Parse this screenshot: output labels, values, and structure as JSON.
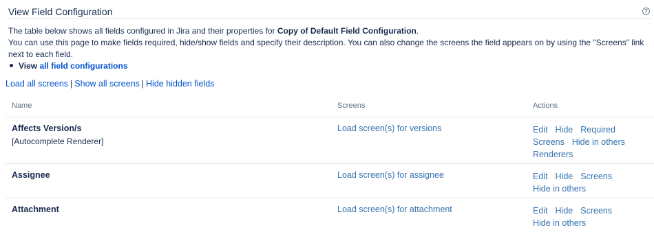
{
  "page": {
    "title": "View Field Configuration",
    "help_icon": "?"
  },
  "intro": {
    "line1_prefix": "The table below shows all fields configured in Jira and their properties for ",
    "config_name": "Copy of Default Field Configuration",
    "line1_suffix": ".",
    "line2": "You can use this page to make fields required, hide/show fields and specify their description. You can also change the screens the field appears on by using the \"Screens\" link next to each field."
  },
  "bullet": {
    "view_label": "View",
    "link_label": "all field configurations"
  },
  "toplinks": {
    "load_all": "Load all screens",
    "show_all": "Show all screens",
    "hide_hidden": "Hide hidden fields",
    "separator": "|"
  },
  "table": {
    "headers": {
      "name": "Name",
      "screens": "Screens",
      "actions": "Actions"
    },
    "rows": [
      {
        "name": "Affects Version/s",
        "renderer": "[Autocomplete Renderer]",
        "screens_link": "Load screen(s) for versions",
        "actions": [
          "Edit",
          "Hide",
          "Required",
          "Screens",
          "Hide in others",
          "Renderers"
        ]
      },
      {
        "name": "Assignee",
        "renderer": "",
        "screens_link": "Load screen(s) for assignee",
        "actions": [
          "Edit",
          "Hide",
          "Screens",
          "Hide in others"
        ]
      },
      {
        "name": "Attachment",
        "renderer": "",
        "screens_link": "Load screen(s) for attachment",
        "actions": [
          "Edit",
          "Hide",
          "Screens",
          "Hide in others"
        ]
      }
    ]
  }
}
